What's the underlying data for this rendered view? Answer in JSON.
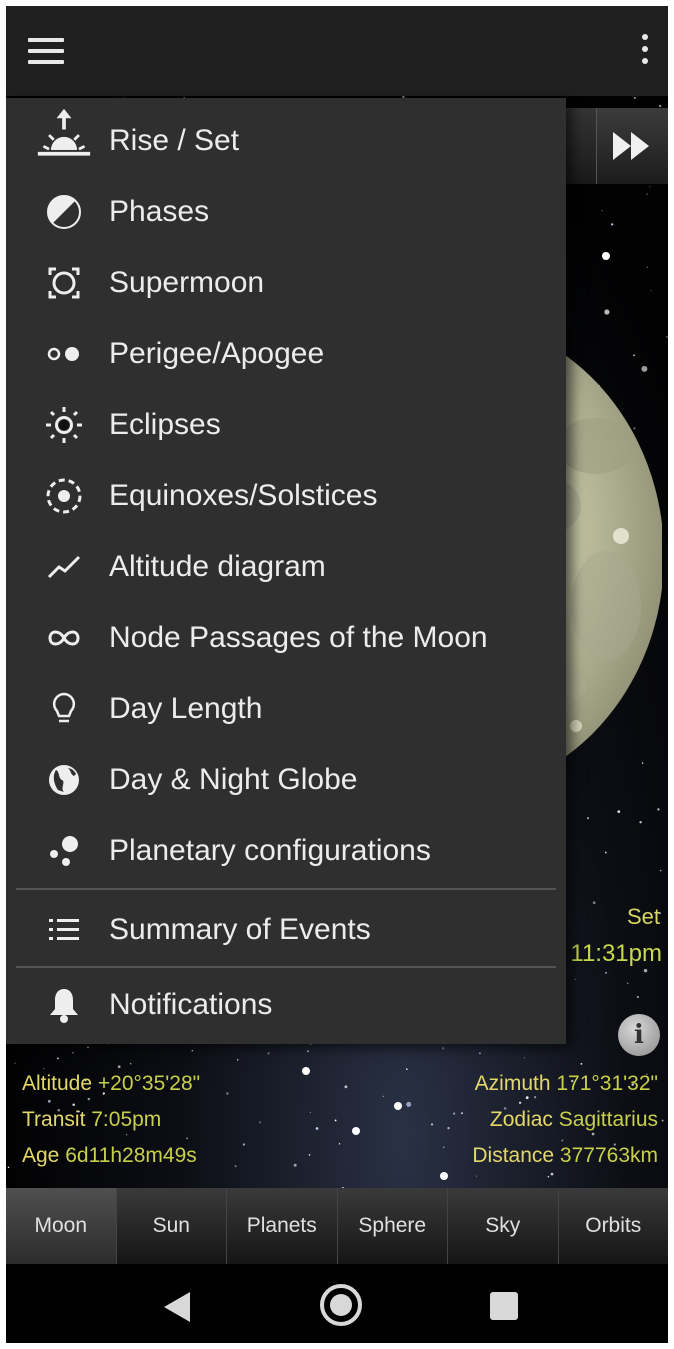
{
  "drawer": {
    "items": [
      {
        "label": "Rise / Set",
        "icon": "sunrise-icon"
      },
      {
        "label": "Phases",
        "icon": "half-circle-icon"
      },
      {
        "label": "Supermoon",
        "icon": "supermoon-icon"
      },
      {
        "label": "Perigee/Apogee",
        "icon": "perigee-apogee-icon"
      },
      {
        "label": "Eclipses",
        "icon": "eclipse-icon"
      },
      {
        "label": "Equinoxes/Solstices",
        "icon": "target-icon"
      },
      {
        "label": "Altitude diagram",
        "icon": "line-chart-icon"
      },
      {
        "label": "Node Passages of the Moon",
        "icon": "infinity-icon"
      },
      {
        "label": "Day Length",
        "icon": "lightbulb-icon"
      },
      {
        "label": "Day & Night Globe",
        "icon": "globe-icon"
      },
      {
        "label": "Planetary configurations",
        "icon": "planets-icon"
      },
      {
        "label": "Summary of Events",
        "icon": "list-icon"
      },
      {
        "label": "Notifications",
        "icon": "bell-icon"
      }
    ]
  },
  "side": {
    "set_label": "Set",
    "set_time": "11:31pm"
  },
  "info": {
    "altitude_label": "Altitude",
    "altitude_value": "+20°35'28\"",
    "transit_label": "Transit",
    "transit_value": "7:05pm",
    "age_label": "Age",
    "age_value": "6d11h28m49s",
    "azimuth_label": "Azimuth",
    "azimuth_value": "171°31'32\"",
    "zodiac_label": "Zodiac",
    "zodiac_value": "Sagittarius",
    "distance_label": "Distance",
    "distance_value": "377763km"
  },
  "tabs": [
    {
      "label": "Moon",
      "active": true
    },
    {
      "label": "Sun",
      "active": false
    },
    {
      "label": "Planets",
      "active": false
    },
    {
      "label": "Sphere",
      "active": false
    },
    {
      "label": "Sky",
      "active": false
    },
    {
      "label": "Orbits",
      "active": false
    }
  ],
  "colors": {
    "drawer_bg": "#2f2f2f",
    "appbar_bg": "#202020",
    "info_label": "#e4d86a",
    "info_value": "#c8d04a"
  }
}
